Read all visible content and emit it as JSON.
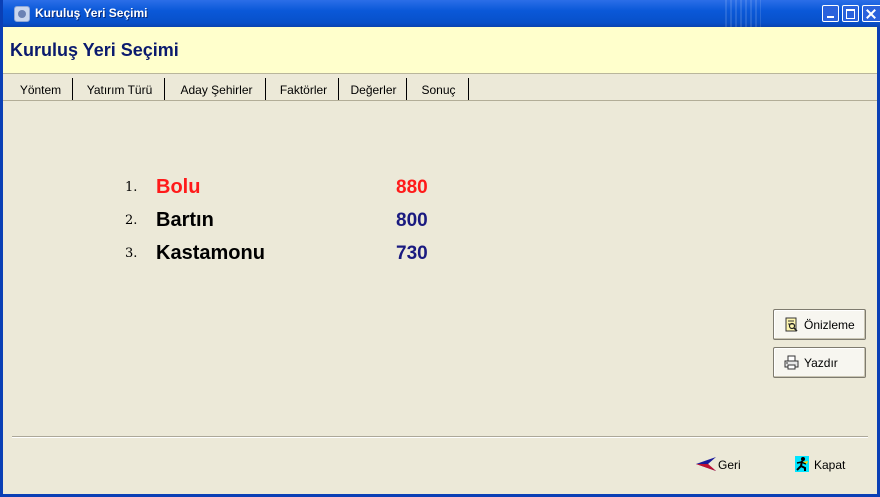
{
  "window": {
    "title": "Kuruluş Yeri Seçimi"
  },
  "header": {
    "title": "Kuruluş Yeri Seçimi"
  },
  "tabs": [
    {
      "label": "Yöntem"
    },
    {
      "label": "Yatırım Türü"
    },
    {
      "label": "Aday Şehirler"
    },
    {
      "label": "Faktörler"
    },
    {
      "label": "Değerler"
    },
    {
      "label": "Sonuç"
    }
  ],
  "active_tab": "Sonuç",
  "results": [
    {
      "rank": "1.",
      "city": "Bolu",
      "score": "880",
      "city_color": "#ff1a1a",
      "score_color": "#ff1a1a"
    },
    {
      "rank": "2.",
      "city": "Bartın",
      "score": "800",
      "city_color": "#000000",
      "score_color": "#1a1a80"
    },
    {
      "rank": "3.",
      "city": "Kastamonu",
      "score": "730",
      "city_color": "#000000",
      "score_color": "#1a1a80"
    }
  ],
  "buttons": {
    "preview": {
      "label": "Önizleme",
      "icon": "preview-icon"
    },
    "print": {
      "label": "Yazdır",
      "icon": "printer-icon"
    },
    "back": {
      "label": "Geri",
      "icon": "back-arrow-icon"
    },
    "close": {
      "label": "Kapat",
      "icon": "running-man-icon"
    }
  },
  "colors": {
    "titlebar": "#0a58d8",
    "header_bg": "#ffffcc",
    "header_text": "#0b1b6e",
    "window_bg": "#ece9d8"
  }
}
